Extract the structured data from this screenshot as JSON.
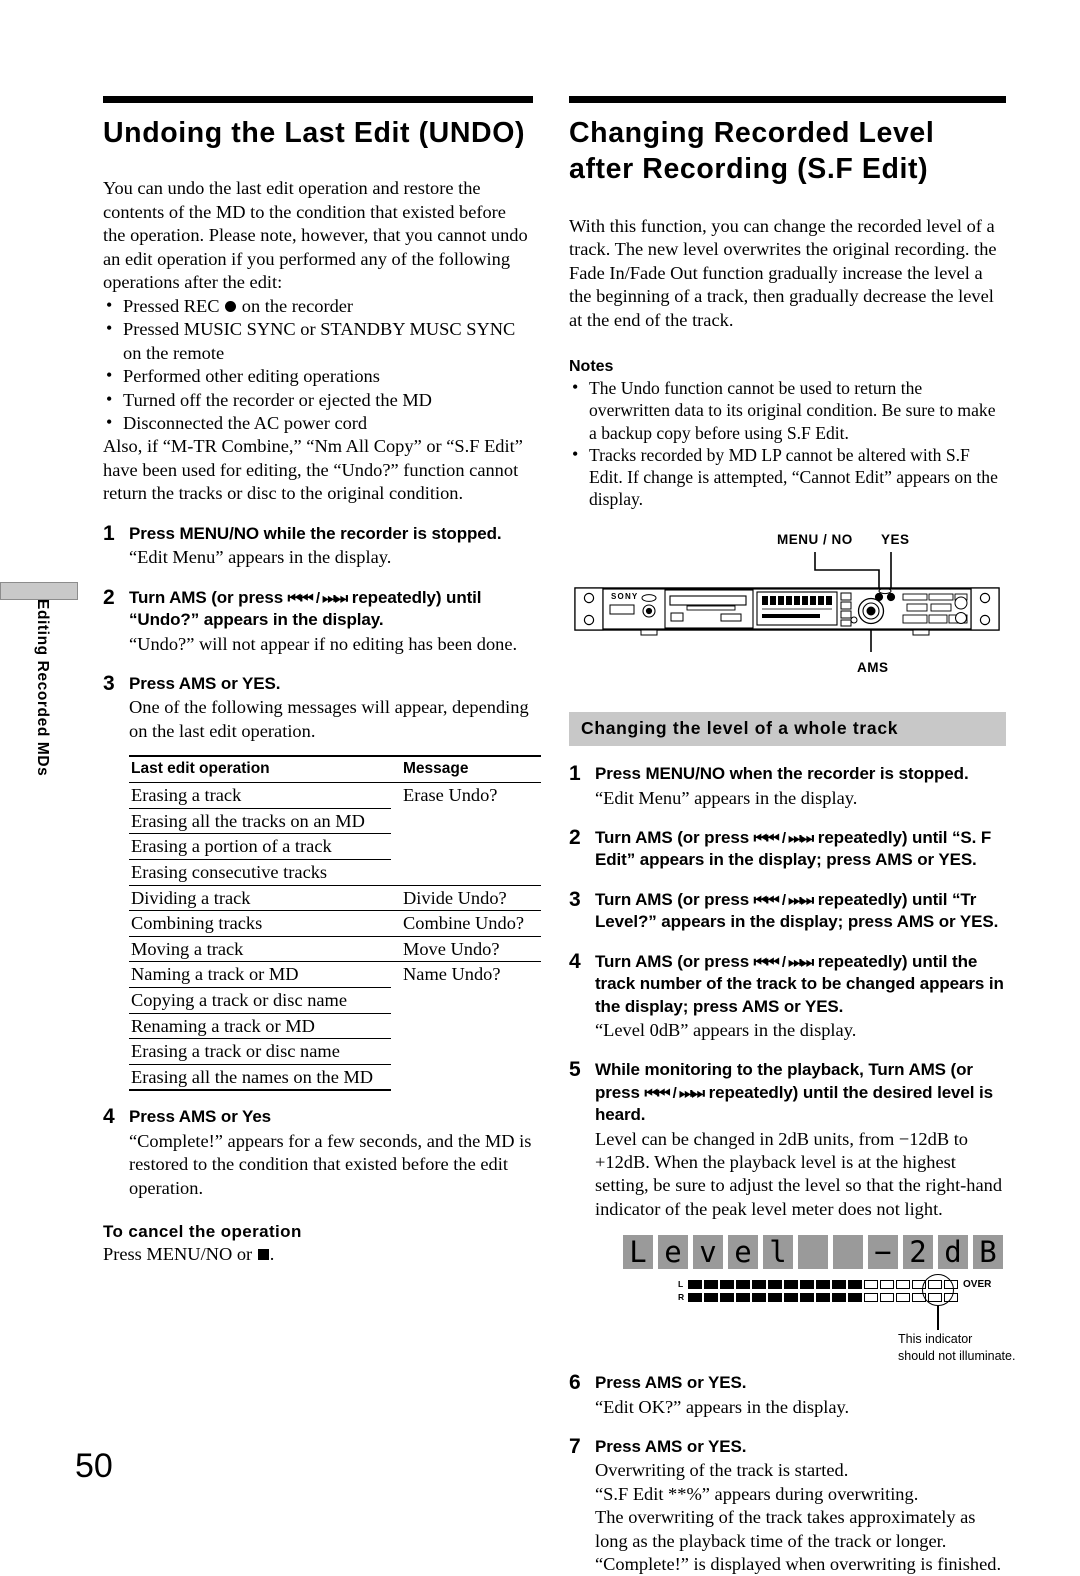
{
  "page": {
    "number": "50",
    "side_tab_label": "Editing Recorded MDs"
  },
  "left_column": {
    "title": "Undoing the Last Edit (UNDO)",
    "intro": "You can undo the last edit operation and restore the contents of the MD to the condition that existed before the operation. Please note, however, that you cannot undo an edit operation if you performed any of the following operations after the edit:",
    "bullets": [
      {
        "pre": "Pressed REC ",
        "icon": "record-dot",
        "post": " on the recorder"
      },
      {
        "pre": "Pressed MUSIC SYNC or STANDBY MUSC SYNC on the remote",
        "icon": "",
        "post": ""
      },
      {
        "pre": "Performed other editing operations",
        "icon": "",
        "post": ""
      },
      {
        "pre": "Turned off the recorder or ejected the MD",
        "icon": "",
        "post": ""
      },
      {
        "pre": "Disconnected the AC power cord",
        "icon": "",
        "post": ""
      }
    ],
    "after_bullets": "Also, if “M-TR Combine,” “Nm All Copy” or “S.F Edit” have been used for editing, the “Undo?” function cannot return the tracks or disc to the original condition.",
    "steps": [
      {
        "num": "1",
        "lead": "Press MENU/NO while the recorder is stopped.",
        "sub": [
          "“Edit Menu” appears in the display."
        ]
      },
      {
        "num": "2",
        "lead_a": "Turn AMS (or press ",
        "lead_b": " repeatedly) until “Undo?” appears in the display.",
        "sub": [
          "“Undo?” will not appear if no editing has been done."
        ]
      },
      {
        "num": "3",
        "lead": "Press AMS or YES.",
        "sub": [
          "One of the following messages will appear, depending on the last edit operation."
        ]
      },
      {
        "num": "4",
        "lead": "Press AMS or Yes",
        "sub": [
          "“Complete!” appears for a few seconds, and the MD is restored to the condition that existed before the edit operation."
        ]
      }
    ],
    "table": {
      "headers": [
        "Last edit operation",
        "Message"
      ],
      "groups": [
        {
          "message": "Erase Undo?",
          "operations": [
            "Erasing a track",
            "Erasing all the tracks on an MD",
            "Erasing a portion of a track",
            "Erasing consecutive tracks"
          ]
        },
        {
          "message": "Divide Undo?",
          "operations": [
            "Dividing a track"
          ]
        },
        {
          "message": "Combine Undo?",
          "operations": [
            "Combining tracks"
          ]
        },
        {
          "message": "Move Undo?",
          "operations": [
            "Moving a track"
          ]
        },
        {
          "message": "Name Undo?",
          "operations": [
            "Naming a track or MD",
            "Copying a track or disc name",
            "Renaming a track or MD",
            "Erasing a track or disc name",
            "Erasing all the names on the MD"
          ]
        }
      ]
    },
    "cancel": {
      "heading": "To cancel the operation",
      "text_pre": "Press MENU/NO or ",
      "icon": "stop-square",
      "text_post": "."
    }
  },
  "right_column": {
    "title": "Changing Recorded Level after Recording (S.F Edit)",
    "intro": "With this function, you can change the recorded level of a track. The new level overwrites the original recording. the Fade In/Fade Out function gradually increase the level a the beginning of a track, then gradually decrease the level at the end of the track.",
    "notes": {
      "heading": "Notes",
      "items": [
        "The Undo function cannot be used to return the overwritten data to its original condition. Be sure to make a backup copy before using S.F Edit.",
        "Tracks recorded by MD LP cannot be altered with S.F Edit. If change is attempted, “Cannot Edit” appears on the display."
      ]
    },
    "device_figure": {
      "label_menu_no": "MENU / NO",
      "label_yes": "YES",
      "label_ams": "AMS",
      "brand": "SONY"
    },
    "section_bar": "Changing the level of a whole track",
    "steps": [
      {
        "num": "1",
        "lead": "Press MENU/NO when the recorder is stopped.",
        "sub": [
          "“Edit Menu” appears in the display."
        ]
      },
      {
        "num": "2",
        "lead_a": "Turn AMS (or press ",
        "lead_b": " repeatedly) until “S. F Edit” appears in the display; press AMS or YES.",
        "sub": []
      },
      {
        "num": "3",
        "lead_a": "Turn AMS (or press ",
        "lead_b": " repeatedly) until “Tr Level?” appears in the display; press AMS or YES.",
        "sub": []
      },
      {
        "num": "4",
        "lead_a": "Turn AMS (or press ",
        "lead_b": " repeatedly) until the track number of the track to be changed appears in the display; press AMS or YES.",
        "sub": [
          "“Level 0dB” appears in the display."
        ]
      },
      {
        "num": "5",
        "lead_a": "While monitoring to the playback, Turn AMS (or press ",
        "lead_b": " repeatedly) until the desired level is heard.",
        "sub": [
          "Level can be changed in 2dB units, from −12dB to +12dB. When the playback level is at the highest setting, be sure to adjust the level so that the right-hand indicator of the peak level meter does not light."
        ]
      },
      {
        "num": "6",
        "lead": "Press AMS or YES.",
        "sub": [
          "“Edit OK?” appears in the display."
        ]
      },
      {
        "num": "7",
        "lead": "Press AMS or YES.",
        "sub": [
          "Overwriting of the track is started.",
          "“S.F Edit **%” appears during overwriting.",
          "The overwriting of the track takes approximately as long as the playback time of the track or longer.",
          "“Complete!” is displayed when overwriting is finished."
        ]
      }
    ],
    "lcd_figure": {
      "display_chars": [
        "L",
        "e",
        "v",
        "e",
        "l",
        " ",
        " ",
        "−",
        "2",
        "d",
        "B"
      ],
      "display_text": "Level  −2dB",
      "left_tag": "L",
      "right_tag": "R",
      "over_label": "OVER",
      "meter_segments_on": 11,
      "meter_segments_off": 6,
      "callout": "This indicator\nshould not illuminate.",
      "callout_line1": "This indicator",
      "callout_line2": "should not illuminate."
    }
  },
  "transport_glyph": "⏮⏮ / ⏭⏭"
}
